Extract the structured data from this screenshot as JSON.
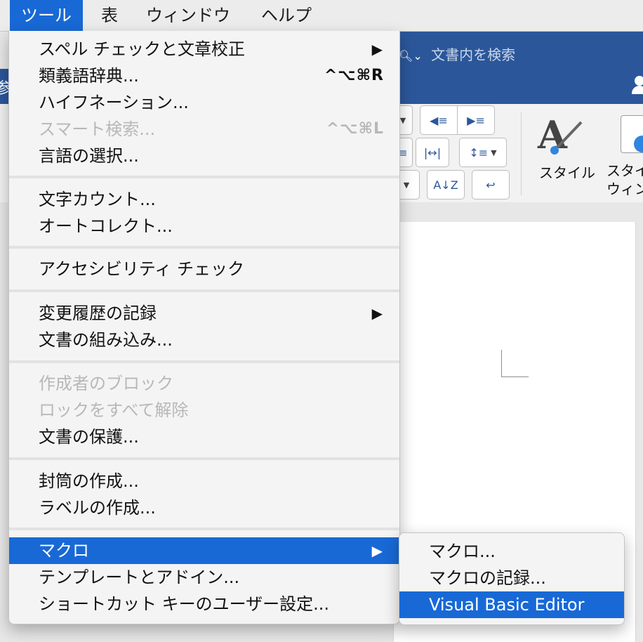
{
  "menubar": {
    "items": [
      {
        "label": "ツール",
        "active": true
      },
      {
        "label": "表"
      },
      {
        "label": "ウィンドウ"
      },
      {
        "label": "ヘルプ"
      }
    ]
  },
  "window": {
    "search_placeholder": "文書内を検索",
    "left_tab_char": "参",
    "styles_label": "スタイル",
    "styles_pane_label_1": "スタイ",
    "styles_pane_label_2": "ウィン"
  },
  "tools_menu": {
    "groups": [
      [
        {
          "label": "スペル チェックと文章校正",
          "submenu": true
        },
        {
          "label": "類義語辞典...",
          "shortcut": "^⌥⌘R"
        },
        {
          "label": "ハイフネーション..."
        },
        {
          "label": "スマート検索...",
          "shortcut": "^⌥⌘L",
          "disabled": true
        },
        {
          "label": "言語の選択..."
        }
      ],
      [
        {
          "label": "文字カウント..."
        },
        {
          "label": "オートコレクト..."
        }
      ],
      [
        {
          "label": "アクセシビリティ チェック"
        }
      ],
      [
        {
          "label": "変更履歴の記録",
          "submenu": true
        },
        {
          "label": "文書の組み込み..."
        }
      ],
      [
        {
          "label": "作成者のブロック",
          "disabled": true
        },
        {
          "label": "ロックをすべて解除",
          "disabled": true
        },
        {
          "label": "文書の保護..."
        }
      ],
      [
        {
          "label": "封筒の作成..."
        },
        {
          "label": "ラベルの作成..."
        }
      ],
      [
        {
          "label": "マクロ",
          "submenu": true,
          "highlighted": true
        },
        {
          "label": "テンプレートとアドイン..."
        },
        {
          "label": "ショートカット キーのユーザー設定..."
        }
      ]
    ]
  },
  "macro_submenu": {
    "items": [
      {
        "label": "マクロ..."
      },
      {
        "label": "マクロの記録..."
      },
      {
        "label": "Visual Basic Editor",
        "highlighted": true
      }
    ]
  },
  "colors": {
    "highlight": "#1869d6",
    "ribbon_blue": "#2b579a",
    "disabled_text": "#b8b8b8"
  }
}
